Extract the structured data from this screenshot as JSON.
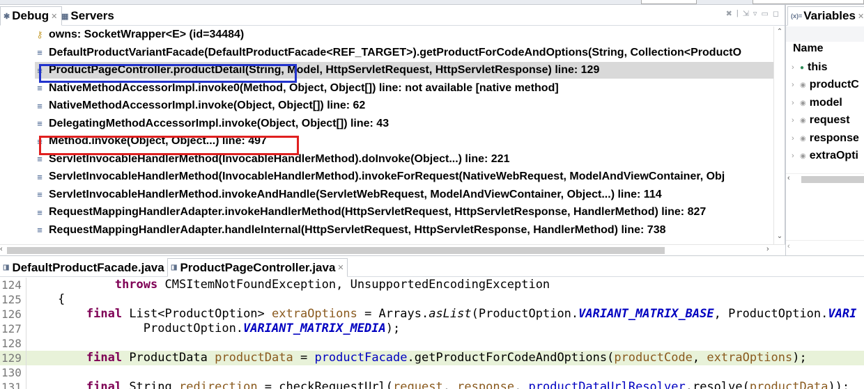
{
  "debug_view": {
    "tabs": [
      {
        "label": "Debug",
        "active": true
      },
      {
        "label": "Servers",
        "active": false
      }
    ],
    "stack_frames": [
      {
        "text": "owns: SocketWrapper<E>  (id=34484)",
        "kind": "owns"
      },
      {
        "text": "DefaultProductVariantFacade(DefaultProductFacade<REF_TARGET>).getProductForCodeAndOptions(String, Collection<ProductO",
        "kind": "frame"
      },
      {
        "text": "ProductPageController.productDetail(String, Model, HttpServletRequest, HttpServletResponse) line: 129",
        "kind": "frame",
        "selected": true,
        "highlight": "blue"
      },
      {
        "text": "NativeMethodAccessorImpl.invoke0(Method, Object, Object[]) line: not available [native method]",
        "kind": "frame"
      },
      {
        "text": "NativeMethodAccessorImpl.invoke(Object, Object[]) line: 62",
        "kind": "frame"
      },
      {
        "text": "DelegatingMethodAccessorImpl.invoke(Object, Object[]) line: 43",
        "kind": "frame"
      },
      {
        "text": "Method.invoke(Object, Object...) line: 497",
        "kind": "frame",
        "highlight": "red"
      },
      {
        "text": "ServletInvocableHandlerMethod(InvocableHandlerMethod).doInvoke(Object...) line: 221",
        "kind": "frame"
      },
      {
        "text": "ServletInvocableHandlerMethod(InvocableHandlerMethod).invokeForRequest(NativeWebRequest, ModelAndViewContainer, Obj",
        "kind": "frame"
      },
      {
        "text": "ServletInvocableHandlerMethod.invokeAndHandle(ServletWebRequest, ModelAndViewContainer, Object...) line: 114",
        "kind": "frame"
      },
      {
        "text": "RequestMappingHandlerAdapter.invokeHandlerMethod(HttpServletRequest, HttpServletResponse, HandlerMethod) line: 827",
        "kind": "frame"
      },
      {
        "text": "RequestMappingHandlerAdapter.handleInternal(HttpServletRequest, HttpServletResponse, HandlerMethod) line: 738",
        "kind": "frame"
      }
    ]
  },
  "variables_view": {
    "tab_label": "Variables",
    "column_header": "Name",
    "rows": [
      {
        "name": "this",
        "dot_color": "#2e8b57"
      },
      {
        "name": "productC",
        "dot_color": "#9a9a9a"
      },
      {
        "name": "model",
        "dot_color": "#9a9a9a"
      },
      {
        "name": "request",
        "dot_color": "#9a9a9a"
      },
      {
        "name": "response",
        "dot_color": "#9a9a9a"
      },
      {
        "name": "extraOpti",
        "dot_color": "#9a9a9a"
      }
    ]
  },
  "editor": {
    "tabs": [
      {
        "label": "DefaultProductFacade.java",
        "active": false
      },
      {
        "label": "ProductPageController.java",
        "active": true
      }
    ],
    "lines": [
      {
        "num": "124",
        "highlight": false,
        "segments": [
          {
            "t": "            "
          },
          {
            "t": "throws",
            "c": "kw"
          },
          {
            "t": " CMSItemNotFoundException, UnsupportedEncodingException"
          }
        ]
      },
      {
        "num": "125",
        "highlight": false,
        "segments": [
          {
            "t": "    {"
          }
        ]
      },
      {
        "num": "126",
        "highlight": false,
        "segments": [
          {
            "t": "        "
          },
          {
            "t": "final",
            "c": "kw"
          },
          {
            "t": " List<ProductOption> "
          },
          {
            "t": "extraOptions",
            "c": "fld"
          },
          {
            "t": " = Arrays."
          },
          {
            "t": "asList",
            "c": "sm"
          },
          {
            "t": "(ProductOption."
          },
          {
            "t": "VARIANT_MATRIX_BASE",
            "c": "sf"
          },
          {
            "t": ", ProductOption."
          },
          {
            "t": "VARI",
            "c": "sf"
          }
        ]
      },
      {
        "num": "127",
        "highlight": false,
        "segments": [
          {
            "t": "                ProductOption."
          },
          {
            "t": "VARIANT_MATRIX_MEDIA",
            "c": "sf"
          },
          {
            "t": ");"
          }
        ]
      },
      {
        "num": "128",
        "highlight": false,
        "segments": [
          {
            "t": ""
          }
        ]
      },
      {
        "num": "129",
        "highlight": true,
        "segments": [
          {
            "t": "        "
          },
          {
            "t": "final",
            "c": "kw"
          },
          {
            "t": " ProductData "
          },
          {
            "t": "productData",
            "c": "fld"
          },
          {
            "t": " = "
          },
          {
            "t": "productFacade",
            "c": "pf"
          },
          {
            "t": ".getProductForCodeAndOptions("
          },
          {
            "t": "productCode",
            "c": "fld"
          },
          {
            "t": ", "
          },
          {
            "t": "extraOptions",
            "c": "fld"
          },
          {
            "t": ");"
          }
        ]
      },
      {
        "num": "130",
        "highlight": false,
        "segments": [
          {
            "t": ""
          }
        ]
      },
      {
        "num": "131",
        "highlight": false,
        "segments": [
          {
            "t": "        "
          },
          {
            "t": "final",
            "c": "kw"
          },
          {
            "t": " String "
          },
          {
            "t": "redirection",
            "c": "fld"
          },
          {
            "t": " = checkRequestUrl("
          },
          {
            "t": "request",
            "c": "fld"
          },
          {
            "t": ", "
          },
          {
            "t": "response",
            "c": "fld"
          },
          {
            "t": ", "
          },
          {
            "t": "productDataUrlResolver",
            "c": "pf"
          },
          {
            "t": ".resolve("
          },
          {
            "t": "productData",
            "c": "fld"
          },
          {
            "t": "));"
          }
        ]
      }
    ]
  }
}
